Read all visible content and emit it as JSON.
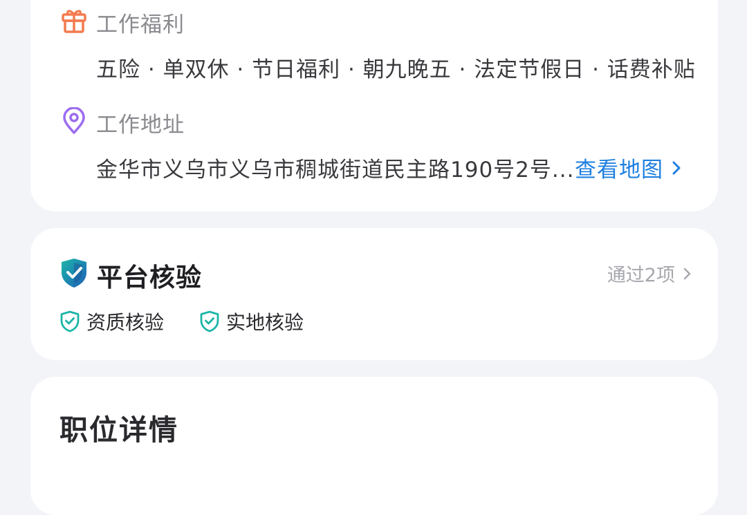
{
  "benefits": {
    "icon": "gift-icon",
    "title": "工作福利",
    "items": "五险 · 单双休 · 节日福利 · 朝九晚五 · 法定节假日 · 话费补贴"
  },
  "address": {
    "icon": "location-pin-icon",
    "title": "工作地址",
    "text": "金华市义乌市义乌市稠城街道民主路190号2号...",
    "map_link": "查看地图"
  },
  "verification": {
    "icon": "shield-check-icon",
    "title": "平台核验",
    "summary": "通过2项",
    "items": [
      "资质核验",
      "实地核验"
    ]
  },
  "details": {
    "title": "职位详情"
  },
  "colors": {
    "gift": "#f47b4f",
    "pin": "#9b6cf0",
    "link": "#1e7fe0",
    "shield": "#1bb5a7",
    "shield_dark": "#1f5fb8"
  }
}
